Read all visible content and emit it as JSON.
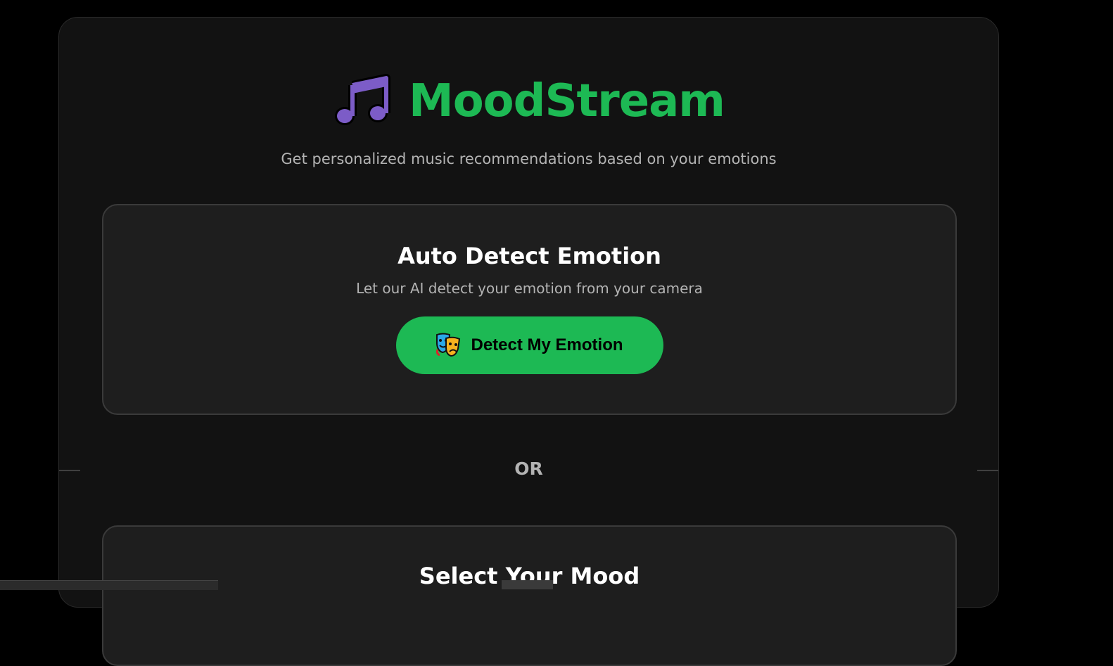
{
  "header": {
    "title": "MoodStream",
    "subtitle": "Get personalized music recommendations based on your emotions",
    "logo_icon": "music-note-icon"
  },
  "auto_detect": {
    "title": "Auto Detect Emotion",
    "description": "Let our AI detect your emotion from your camera",
    "button_label": "Detect My Emotion",
    "button_icon": "theater-masks-icon"
  },
  "divider": {
    "label": "OR"
  },
  "select_mood": {
    "title": "Select Your Mood"
  },
  "colors": {
    "accent": "#1db954",
    "background": "#121212",
    "card": "#1e1e1e",
    "note_icon": "#7c5cc7"
  }
}
